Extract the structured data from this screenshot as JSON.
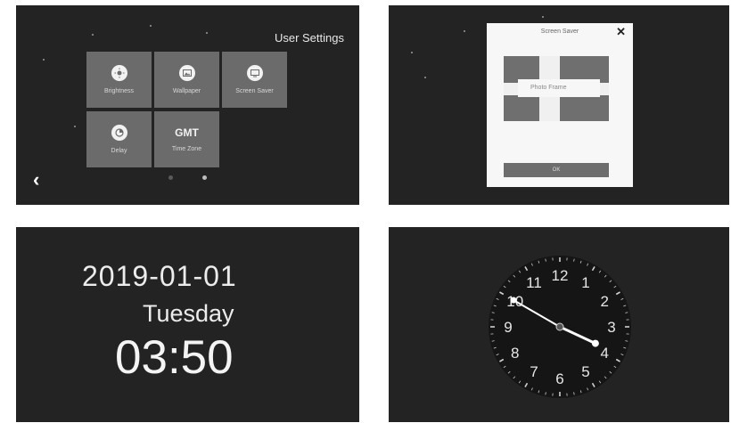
{
  "settings_panel": {
    "title": "User Settings",
    "tiles": [
      {
        "label": "Brightness",
        "icon": "brightness-icon"
      },
      {
        "label": "Wallpaper",
        "icon": "wallpaper-icon"
      },
      {
        "label": "Screen Saver",
        "icon": "screen-saver-icon"
      },
      {
        "label": "Delay",
        "icon": "delay-icon"
      },
      {
        "label": "Time Zone",
        "icon_text": "GMT"
      }
    ],
    "back_icon": "chevron-left-icon",
    "page_dots": 2
  },
  "screen_saver_dialog": {
    "title": "Screen Saver",
    "close_icon": "close-icon",
    "option_value": "Photo Frame",
    "ok_label": "OK"
  },
  "date_time_panel": {
    "date": "2019-01-01",
    "weekday": "Tuesday",
    "time": "03:50"
  },
  "analog_clock": {
    "numerals": [
      "12",
      "1",
      "2",
      "3",
      "4",
      "5",
      "6",
      "7",
      "8",
      "9",
      "10",
      "11"
    ],
    "hour": 3,
    "minute": 50
  },
  "colors": {
    "panel_bg": "#232323",
    "tile_bg": "#6b6b6b",
    "dialog_bg": "#f7f7f7"
  }
}
